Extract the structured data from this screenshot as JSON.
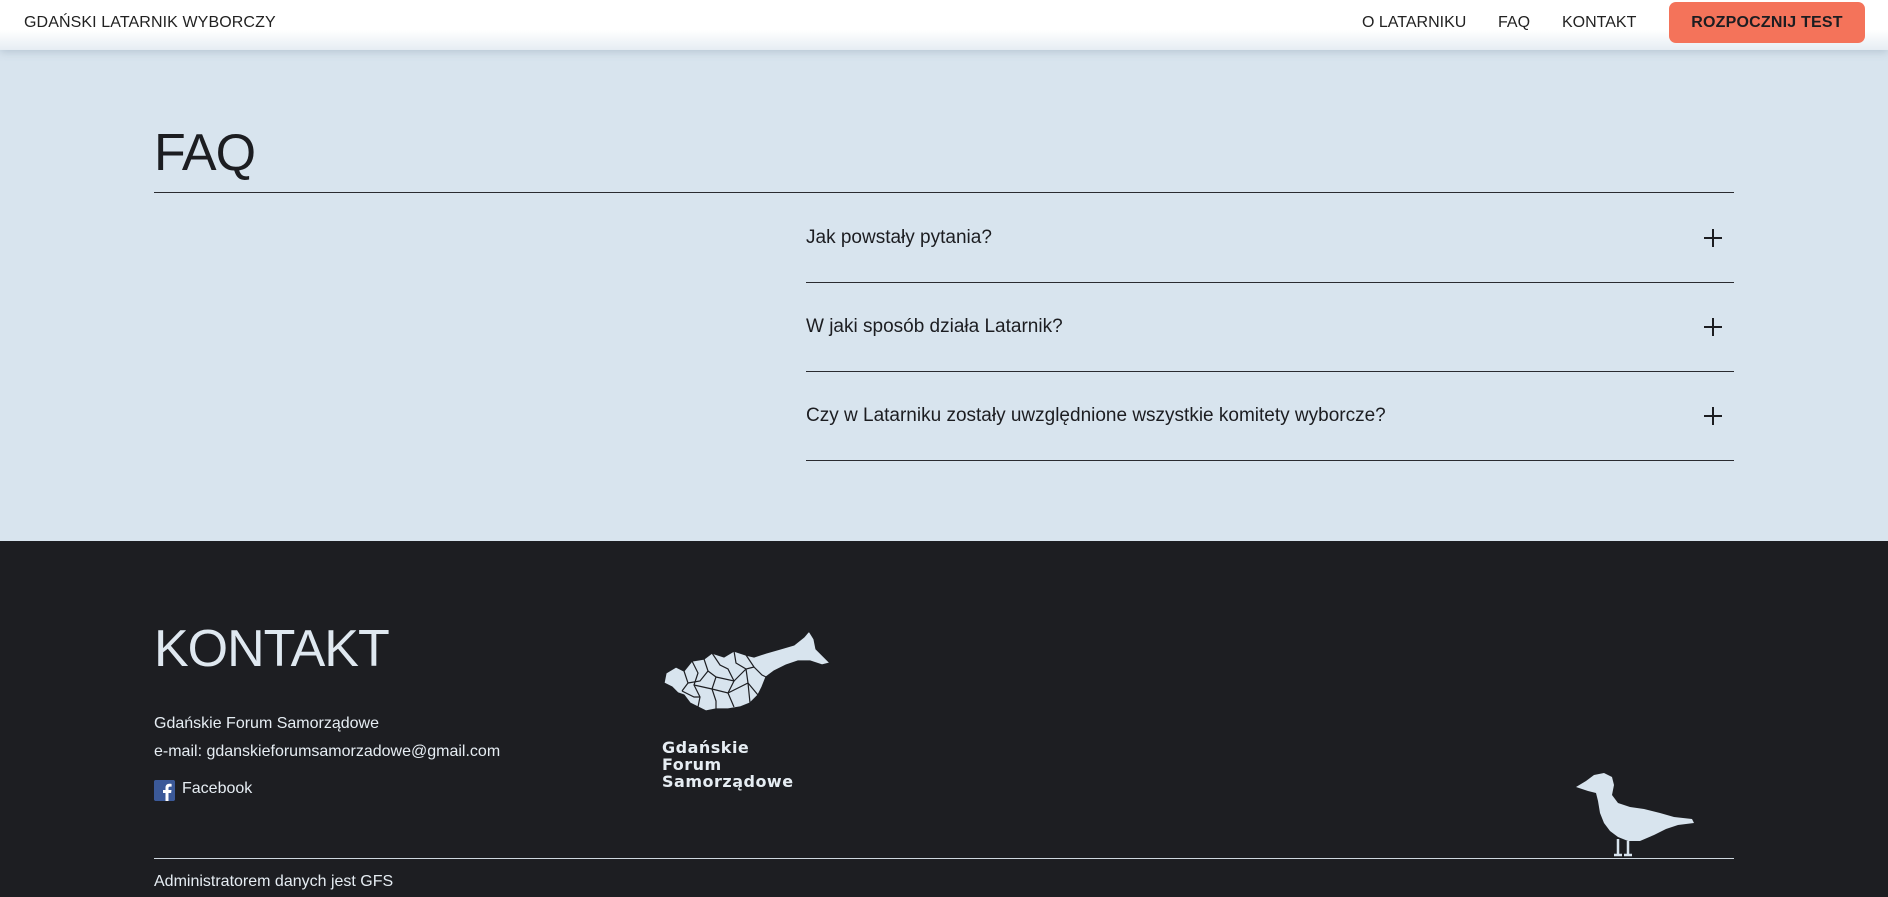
{
  "header": {
    "brand": "GDAŃSKI LATARNIK WYBORCZY",
    "nav": [
      "O LATARNIKU",
      "FAQ",
      "KONTAKT"
    ],
    "cta_label": "ROZPOCZNIJ TEST"
  },
  "faq": {
    "title": "FAQ",
    "items": [
      {
        "question": "Jak powstały pytania?"
      },
      {
        "question": "W jaki sposób działa Latarnik?"
      },
      {
        "question": "Czy w Latarniku zostały uwzględnione wszystkie komitety wyborcze?"
      }
    ]
  },
  "footer": {
    "title": "KONTAKT",
    "org_name": "Gdańskie Forum Samorządowe",
    "email_line": "e-mail: gdanskieforumsamorzadowe@gmail.com",
    "facebook_label": "Facebook",
    "logo_text": [
      "Gdańskie",
      "Forum",
      "Samorządowe"
    ],
    "admin_note": "Administratorem danych jest GFS"
  },
  "colors": {
    "accent": "#f4735a",
    "background": "#d8e4ee",
    "footer_bg": "#1d1e22",
    "facebook": "#3b5998"
  },
  "icons": [
    "plus-icon",
    "facebook-icon",
    "gfs-map-logo",
    "seagull-icon"
  ]
}
